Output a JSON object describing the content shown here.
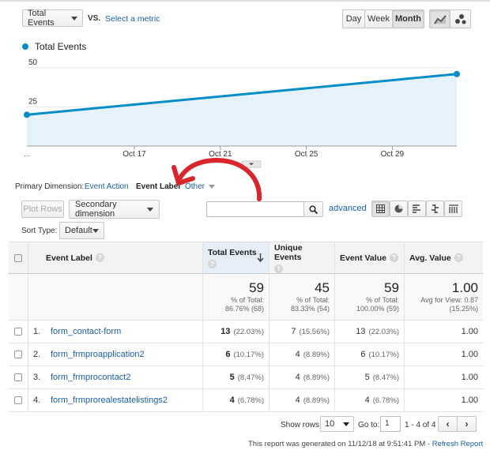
{
  "metric_select": {
    "value": "Total Events",
    "vs_label": "VS.",
    "select_metric": "Select a metric"
  },
  "period": {
    "day": "Day",
    "week": "Week",
    "month": "Month",
    "active": "Month"
  },
  "legend": {
    "series": "Total Events",
    "color": "#058dc7"
  },
  "chart_data": {
    "type": "area",
    "x_ticks": [
      "Oct 17",
      "Oct 21",
      "Oct 25",
      "Oct 29"
    ],
    "x_ellipsis": "...",
    "y_ticks": [
      "25",
      "50"
    ],
    "ylim": [
      0,
      59
    ],
    "series": [
      {
        "name": "Total Events",
        "points": [
          [
            "Oct 12",
            20
          ],
          [
            "Nov 1",
            46
          ]
        ]
      }
    ],
    "color": "#058dc7"
  },
  "dimension": {
    "label": "Primary Dimension:",
    "options": [
      "Event Action",
      "Event Label",
      "Other"
    ],
    "active": "Event Label"
  },
  "toolbar": {
    "plot_rows": "Plot Rows",
    "secondary": "Secondary dimension",
    "search_placeholder": "",
    "advanced": "advanced"
  },
  "sort": {
    "label": "Sort Type:",
    "value": "Default"
  },
  "table": {
    "columns": [
      "Event Label",
      "Total Events",
      "Unique Events",
      "Event Value",
      "Avg. Value"
    ],
    "totals": [
      {
        "value": "59",
        "line1": "% of Total:",
        "line2": "86.76% (68)"
      },
      {
        "value": "45",
        "line1": "% of Total:",
        "line2": "83.33% (54)"
      },
      {
        "value": "59",
        "line1": "% of Total:",
        "line2": "100.00% (59)"
      },
      {
        "value": "1.00",
        "line1": "Avg for View: 0.87",
        "line2": "(15.25%)"
      }
    ],
    "rows": [
      {
        "index": "1.",
        "label": "form_contact-form",
        "total": "13",
        "total_pct": "(22.03%)",
        "unique": "7",
        "unique_pct": "(15.56%)",
        "value": "13",
        "value_pct": "(22.03%)",
        "avg": "1.00"
      },
      {
        "index": "2.",
        "label": "form_frmproapplication2",
        "total": "6",
        "total_pct": "(10.17%)",
        "unique": "4",
        "unique_pct": "(8.89%)",
        "value": "6",
        "value_pct": "(10.17%)",
        "avg": "1.00"
      },
      {
        "index": "3.",
        "label": "form_frmprocontact2",
        "total": "5",
        "total_pct": "(8.47%)",
        "unique": "4",
        "unique_pct": "(8.89%)",
        "value": "5",
        "value_pct": "(8.47%)",
        "avg": "1.00"
      },
      {
        "index": "4.",
        "label": "form_frmprorealestatelistings2",
        "total": "4",
        "total_pct": "(6.78%)",
        "unique": "4",
        "unique_pct": "(8.89%)",
        "value": "4",
        "value_pct": "(6.78%)",
        "avg": "1.00"
      }
    ]
  },
  "pagination": {
    "show_rows_label": "Show rows:",
    "show_rows": "10",
    "goto_label": "Go to:",
    "goto": "1",
    "range": "1 - 4 of 4"
  },
  "footer": {
    "text": "This report was generated on 11/12/18 at 9:51:41 PM - ",
    "refresh": "Refresh Report"
  },
  "annotation": {
    "color": "#d9262c"
  }
}
